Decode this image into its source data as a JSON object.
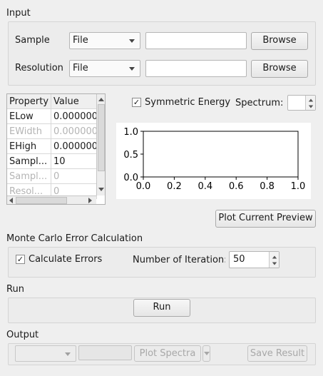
{
  "input": {
    "title": "Input",
    "sample": {
      "label": "Sample",
      "type_value": "File",
      "path_value": "",
      "browse_label": "Browse"
    },
    "resolution": {
      "label": "Resolution",
      "type_value": "File",
      "path_value": "",
      "browse_label": "Browse"
    }
  },
  "property_table": {
    "headers": [
      "Property",
      "Value"
    ],
    "rows": [
      {
        "property": "ELow",
        "value": "0.000000",
        "enabled": true
      },
      {
        "property": "EWidth",
        "value": "0.000000",
        "enabled": false
      },
      {
        "property": "EHigh",
        "value": "0.000000",
        "enabled": true
      },
      {
        "property": "Sampl...",
        "value": "10",
        "enabled": true
      },
      {
        "property": "Sampl...",
        "value": "0",
        "enabled": false
      },
      {
        "property": "Resol...",
        "value": "0",
        "enabled": false
      }
    ]
  },
  "options": {
    "symmetric_energy_label": "Symmetric Energy",
    "symmetric_energy_checked": true,
    "spectrum_label": "Spectrum:",
    "spectrum_value": ""
  },
  "chart_data": {
    "type": "line",
    "series": [],
    "xlim": [
      0.0,
      1.0
    ],
    "ylim": [
      0.0,
      1.0
    ],
    "x_ticks": [
      "0.0",
      "0.2",
      "0.4",
      "0.6",
      "0.8",
      "1.0"
    ],
    "y_ticks": [
      "0.0",
      "0.5",
      "1.0"
    ],
    "grid": false
  },
  "preview": {
    "plot_current_preview_label": "Plot Current Preview"
  },
  "monte_carlo": {
    "title": "Monte Carlo Error Calculation",
    "calculate_errors_label": "Calculate Errors",
    "calculate_errors_checked": true,
    "iterations_label": "Number of Iteration:",
    "iterations_value": "50"
  },
  "run": {
    "title": "Run",
    "run_label": "Run"
  },
  "output": {
    "title": "Output",
    "workspace_value": "",
    "plot_value": "",
    "plot_spectra_label": "Plot Spectra",
    "save_result_label": "Save Result"
  },
  "icons": {
    "check": "✓"
  }
}
